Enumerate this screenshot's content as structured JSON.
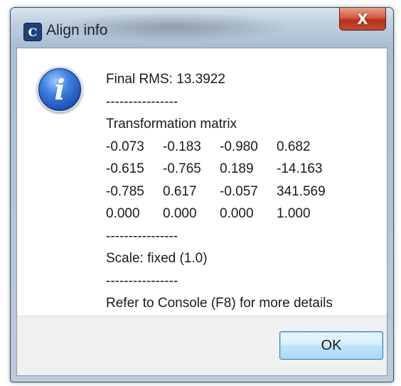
{
  "window": {
    "title": "Align info",
    "app_icon": "cloudcompare-icon",
    "close_label": "X"
  },
  "message": {
    "icon": "info-icon",
    "rms": "Final RMS: 13.3922",
    "separator": "----------------",
    "matrix_title": "Transformation matrix",
    "matrix": [
      [
        "-0.073",
        "-0.183",
        "-0.980",
        "0.682"
      ],
      [
        "-0.615",
        "-0.765",
        "0.189",
        "-14.163"
      ],
      [
        "-0.785",
        "0.617",
        "-0.057",
        "341.569"
      ],
      [
        "0.000",
        "0.000",
        "0.000",
        "1.000"
      ]
    ],
    "scale": "Scale: fixed (1.0)",
    "console_hint": "Refer to Console (F8) for more details"
  },
  "buttons": {
    "ok_label": "OK"
  }
}
